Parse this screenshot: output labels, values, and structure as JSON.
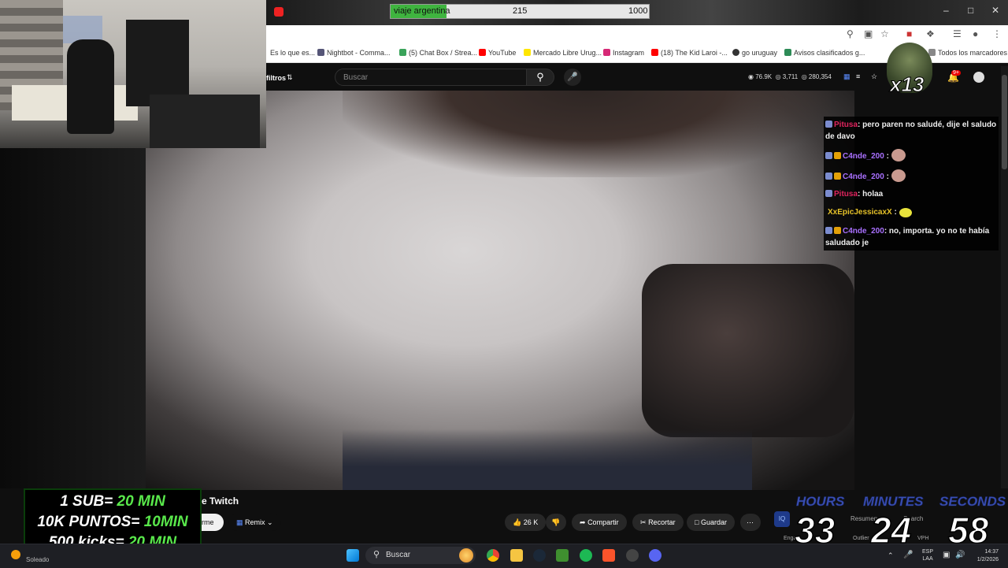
{
  "stream_goal": {
    "label": "viaje argentina",
    "current": "215",
    "target": "1000",
    "progress": 0.215
  },
  "bookmarks": [
    {
      "label": "Es lo que es...",
      "color": "#888888"
    },
    {
      "label": "Nightbot - Comma...",
      "color": "#555577"
    },
    {
      "label": "(5) Chat Box / Strea...",
      "color": "#3aa35a"
    },
    {
      "label": "YouTube",
      "color": "#ff0000"
    },
    {
      "label": "Mercado Libre Urug...",
      "color": "#ffe600"
    },
    {
      "label": "Instagram",
      "color": "#d62976"
    },
    {
      "label": "(18) The Kid Laroi -...",
      "color": "#ff0000"
    },
    {
      "label": "go uruguay",
      "color": "#333333"
    },
    {
      "label": "Avisos clasificados g...",
      "color": "#2e8b57"
    },
    {
      "label": "Todos los marcadores",
      "color": "#888888"
    }
  ],
  "youtube_header": {
    "filters_label": "filtros",
    "search_placeholder": "Buscar",
    "stats": {
      "views": "76.9K",
      "likes": "3,711",
      "subs": "280,354"
    },
    "notifications_badge": "9+"
  },
  "overlay": {
    "emote_multiplier": "x13"
  },
  "chat": [
    {
      "user": "Pitusa",
      "user_color": "#e0245e",
      "text": ": pero paren no saludé, dije el saludo de davo",
      "emote": false
    },
    {
      "user": "C4nde_200",
      "user_color": "#a970ff",
      "text": " :",
      "emote": true
    },
    {
      "user": "C4nde_200",
      "user_color": "#a970ff",
      "text": " :",
      "emote": true
    },
    {
      "user": "Pitusa",
      "user_color": "#e0245e",
      "text": ": holaa",
      "emote": false
    },
    {
      "user": "XxEpicJessicaxX",
      "user_color": "#e6c229",
      "text": " :",
      "emote": true
    },
    {
      "user": "C4nde_200",
      "user_color": "#a970ff",
      "text": ": no, importa. yo no te había saludado je",
      "emote": false
    }
  ],
  "video_meta": {
    "title_fragment": "e Twitch",
    "subscribe_label": "irme",
    "remix_label": "Remix",
    "likes": "26 K",
    "share_label": "Compartir",
    "clip_label": "Recortar",
    "save_label": "Guardar",
    "summary_label": "Resumen",
    "search_label": "Search",
    "engagement_label": "Engag",
    "outlier_label": "Outlier",
    "vph_label": "VPH"
  },
  "subathon": {
    "line1_prefix": "1 SUB= ",
    "line1_value": "20 MIN",
    "line2_prefix": "10K PUNTOS= ",
    "line2_value": "10MIN",
    "line3_prefix": "500 kicks= ",
    "line3_value": "20 MIN"
  },
  "timer": {
    "hours_label": "HOURS",
    "minutes_label": "MINUTES",
    "seconds_label": "SECONDS",
    "hours": "33",
    "minutes": "24",
    "seconds": "58"
  },
  "taskbar": {
    "weather": "Soleado",
    "search_label": "Buscar",
    "lang_top": "ESP",
    "lang_bottom": "LAA",
    "time": "14:37",
    "date": "1/2/2026"
  }
}
